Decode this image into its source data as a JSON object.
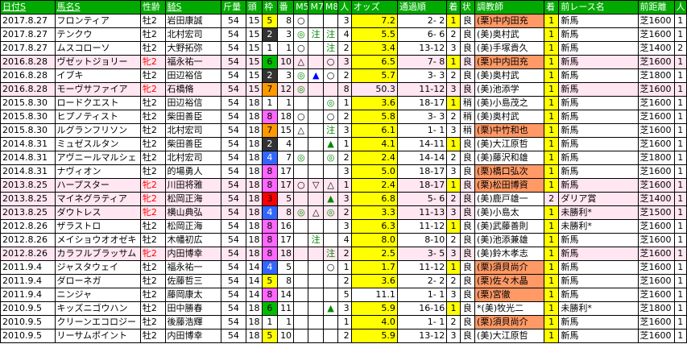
{
  "headers": {
    "date": "日付S",
    "horse": "馬名S",
    "sexage": "性齢",
    "jockey": "騎S",
    "weight": "斤量",
    "heads": "頭",
    "frame": "枠",
    "num": "番",
    "m5": "M5",
    "m7": "M7",
    "m8": "M8",
    "pop": "人",
    "odds": "オッズ",
    "passing": "通過順",
    "finish": "着",
    "cond": "状",
    "trainer": "調教師",
    "prev_finish": "着",
    "prev_race": "前レース名",
    "prev_dist": "前距離",
    "prev_pop": "人"
  },
  "rows": [
    {
      "date": "2017.8.27",
      "horse": "フロンティア",
      "sexage": "牡2",
      "jockey": "岩田康誠",
      "weight": "54",
      "heads": "15",
      "frame": "5",
      "num": "8",
      "m5": "○",
      "m7": "",
      "m8": "",
      "pop": "3",
      "odds": "7.2",
      "passing": "2- 2",
      "finish": "1",
      "cond": "良",
      "trainer": "(栗)中内田充",
      "prev_finish": "1",
      "prev_race": "新馬",
      "prev_dist": "芝1600",
      "prev_pop": "1"
    },
    {
      "date": "2017.8.27",
      "horse": "テンクウ",
      "sexage": "牡2",
      "jockey": "北村宏司",
      "weight": "54",
      "heads": "15",
      "frame": "2",
      "num": "3",
      "m5": "◎",
      "m7": "注",
      "m8": "注",
      "pop": "4",
      "odds": "5.5",
      "passing": "6- 6",
      "finish": "2",
      "cond": "良",
      "trainer": "(美)奥村武",
      "prev_finish": "1",
      "prev_race": "新馬",
      "prev_dist": "芝1600",
      "prev_pop": "1"
    },
    {
      "date": "2017.8.27",
      "horse": "ムスコローソ",
      "sexage": "牡2",
      "jockey": "大野拓弥",
      "weight": "54",
      "heads": "15",
      "frame": "1",
      "num": "1",
      "m5": "○",
      "m7": "",
      "m8": "注",
      "pop": "2",
      "odds": "3.4",
      "passing": "13-12",
      "finish": "3",
      "cond": "良",
      "trainer": "(美)手塚貴久",
      "prev_finish": "1",
      "prev_race": "新馬",
      "prev_dist": "芝1400",
      "prev_pop": "2"
    },
    {
      "date": "2016.8.28",
      "horse": "ヴゼットジョリー",
      "sexage": "牝2",
      "jockey": "福永祐一",
      "weight": "54",
      "heads": "15",
      "frame": "6",
      "num": "10",
      "m5": "△",
      "m7": "",
      "m8": "○",
      "pop": "3",
      "odds": "6.5",
      "passing": "7- 8",
      "finish": "1",
      "cond": "良",
      "trainer": "(栗)中内田充",
      "prev_finish": "1",
      "prev_race": "新馬",
      "prev_dist": "芝1600",
      "prev_pop": "1"
    },
    {
      "date": "2016.8.28",
      "horse": "イブキ",
      "sexage": "牡2",
      "jockey": "田辺裕信",
      "weight": "54",
      "heads": "15",
      "frame": "2",
      "num": "3",
      "m5": "◎",
      "m7": "▲",
      "m8": "○",
      "pop": "2",
      "odds": "5.7",
      "passing": "3- 3",
      "finish": "2",
      "cond": "良",
      "trainer": "(美)奥村武",
      "prev_finish": "1",
      "prev_race": "新馬",
      "prev_dist": "芝1800",
      "prev_pop": "1"
    },
    {
      "date": "2016.8.28",
      "horse": "モーヴサファイア",
      "sexage": "牝2",
      "jockey": "石橋脩",
      "weight": "54",
      "heads": "15",
      "frame": "7",
      "num": "12",
      "m5": "◎",
      "m7": "",
      "m8": "",
      "pop": "8",
      "odds": "50.3",
      "passing": "11-12",
      "finish": "3",
      "cond": "良",
      "trainer": "(美)池添学",
      "prev_finish": "1",
      "prev_race": "新馬",
      "prev_dist": "芝1600",
      "prev_pop": "1"
    },
    {
      "date": "2015.8.30",
      "horse": "ロードクエスト",
      "sexage": "牡2",
      "jockey": "田辺裕信",
      "weight": "54",
      "heads": "18",
      "frame": "1",
      "num": "1",
      "m5": "",
      "m7": "",
      "m8": "◎",
      "pop": "1",
      "odds": "3.6",
      "passing": "18-17",
      "finish": "1",
      "cond": "稍",
      "trainer": "(美)小島茂之",
      "prev_finish": "1",
      "prev_race": "新馬",
      "prev_dist": "芝1600",
      "prev_pop": "1"
    },
    {
      "date": "2015.8.30",
      "horse": "ヒプノティスト",
      "sexage": "牡2",
      "jockey": "柴田善臣",
      "weight": "54",
      "heads": "18",
      "frame": "8",
      "num": "18",
      "m5": "○",
      "m7": "",
      "m8": "○",
      "pop": "2",
      "odds": "5.8",
      "passing": "3- 3",
      "finish": "2",
      "cond": "稍",
      "trainer": "(美)奥村武",
      "prev_finish": "1",
      "prev_race": "新馬",
      "prev_dist": "芝1600",
      "prev_pop": "1"
    },
    {
      "date": "2015.8.30",
      "horse": "ルグランフリソン",
      "sexage": "牡2",
      "jockey": "北村宏司",
      "weight": "54",
      "heads": "18",
      "frame": "7",
      "num": "15",
      "m5": "△",
      "m7": "",
      "m8": "注",
      "pop": "3",
      "odds": "6.1",
      "passing": "1- 1",
      "finish": "3",
      "cond": "稍",
      "trainer": "(栗)中竹和也",
      "prev_finish": "1",
      "prev_race": "新馬",
      "prev_dist": "芝1600",
      "prev_pop": "1"
    },
    {
      "date": "2014.8.31",
      "horse": "ミュゼスルタン",
      "sexage": "牡2",
      "jockey": "柴田善臣",
      "weight": "54",
      "heads": "18",
      "frame": "2",
      "num": "4",
      "m5": "",
      "m7": "",
      "m8": "▲",
      "pop": "1",
      "odds": "4.1",
      "passing": "14-11",
      "finish": "1",
      "cond": "良",
      "trainer": "(美)大江原哲",
      "prev_finish": "1",
      "prev_race": "新馬",
      "prev_dist": "芝1600",
      "prev_pop": "1"
    },
    {
      "date": "2014.8.31",
      "horse": "アヴニールマルシェ",
      "sexage": "牡2",
      "jockey": "北村宏司",
      "weight": "54",
      "heads": "18",
      "frame": "4",
      "num": "7",
      "m5": "◎",
      "m7": "",
      "m8": "◎",
      "pop": "2",
      "odds": "2.4",
      "passing": "14-14",
      "finish": "2",
      "cond": "良",
      "trainer": "(美)藤沢和雄",
      "prev_finish": "1",
      "prev_race": "新馬",
      "prev_dist": "芝1800",
      "prev_pop": "1"
    },
    {
      "date": "2014.8.31",
      "horse": "ナヴィオン",
      "sexage": "牡2",
      "jockey": "的場勇人",
      "weight": "54",
      "heads": "18",
      "frame": "8",
      "num": "17",
      "m5": "",
      "m7": "",
      "m8": "",
      "pop": "3",
      "odds": "5.0",
      "passing": "18-17",
      "finish": "3",
      "cond": "良",
      "trainer": "(栗)橋口弘次",
      "prev_finish": "1",
      "prev_race": "新馬",
      "prev_dist": "芝1600",
      "prev_pop": "1"
    },
    {
      "date": "2013.8.25",
      "horse": "ハープスター",
      "sexage": "牝2",
      "jockey": "川田将雅",
      "weight": "54",
      "heads": "18",
      "frame": "8",
      "num": "17",
      "m5": "○",
      "m7": "▽",
      "m8": "△",
      "pop": "1",
      "odds": "2.4",
      "passing": "18-17",
      "finish": "1",
      "cond": "良",
      "trainer": "(栗)松田博資",
      "prev_finish": "1",
      "prev_race": "新馬",
      "prev_dist": "芝1600",
      "prev_pop": "1"
    },
    {
      "date": "2013.8.25",
      "horse": "マイネグラティア",
      "sexage": "牝2",
      "jockey": "松岡正海",
      "weight": "54",
      "heads": "18",
      "frame": "3",
      "num": "5",
      "m5": "",
      "m7": "",
      "m8": "▲",
      "pop": "3",
      "odds": "6.8",
      "passing": "5- 6",
      "finish": "2",
      "cond": "良",
      "trainer": "(美)鹿戸雄一",
      "prev_finish": "2",
      "prev_race": "ダリア賞",
      "prev_dist": "芝1400",
      "prev_pop": "1"
    },
    {
      "date": "2013.8.25",
      "horse": "ダウトレス",
      "sexage": "牝2",
      "jockey": "横山典弘",
      "weight": "54",
      "heads": "18",
      "frame": "4",
      "num": "8",
      "m5": "◎",
      "m7": "△",
      "m8": "◎",
      "pop": "2",
      "odds": "3.3",
      "passing": "11-13",
      "finish": "3",
      "cond": "良",
      "trainer": "(美)小島太",
      "prev_finish": "1",
      "prev_race": "未勝利*",
      "prev_dist": "芝1500",
      "prev_pop": "1"
    },
    {
      "date": "2012.8.26",
      "horse": "ザラストロ",
      "sexage": "牡2",
      "jockey": "松岡正海",
      "weight": "54",
      "heads": "18",
      "frame": "8",
      "num": "16",
      "m5": "",
      "m7": "",
      "m8": "",
      "pop": "3",
      "odds": "6.3",
      "passing": "11-12",
      "finish": "1",
      "cond": "良",
      "trainer": "(美)武藤善則",
      "prev_finish": "1",
      "prev_race": "未勝利*",
      "prev_dist": "芝1600",
      "prev_pop": "1"
    },
    {
      "date": "2012.8.26",
      "horse": "メイショウオオゼキ",
      "sexage": "牡2",
      "jockey": "木幡初広",
      "weight": "54",
      "heads": "18",
      "frame": "8",
      "num": "17",
      "m5": "",
      "m7": "注",
      "m8": "",
      "pop": "4",
      "odds": "8.0",
      "passing": "8-10",
      "finish": "2",
      "cond": "良",
      "trainer": "(美)池添兼雄",
      "prev_finish": "1",
      "prev_race": "新馬",
      "prev_dist": "芝1600",
      "prev_pop": "1"
    },
    {
      "date": "2012.8.26",
      "horse": "カラフルブラッサム",
      "sexage": "牝2",
      "jockey": "内田博幸",
      "weight": "54",
      "heads": "18",
      "frame": "8",
      "num": "18",
      "m5": "",
      "m7": "",
      "m8": "注",
      "pop": "2",
      "odds": "2.5",
      "passing": "3- 5",
      "finish": "3",
      "cond": "良",
      "trainer": "(美)鈴木孝志",
      "prev_finish": "1",
      "prev_race": "新馬",
      "prev_dist": "芝1600",
      "prev_pop": "1"
    },
    {
      "date": "2011.9.4",
      "horse": "ジャスタウェイ",
      "sexage": "牡2",
      "jockey": "福永祐一",
      "weight": "54",
      "heads": "14",
      "frame": "4",
      "num": "5",
      "m5": "",
      "m7": "",
      "m8": "○",
      "pop": "1",
      "odds": "1.7",
      "passing": "11-12",
      "finish": "1",
      "cond": "良",
      "trainer": "(栗)須貝尚介",
      "prev_finish": "1",
      "prev_race": "新馬",
      "prev_dist": "芝1600",
      "prev_pop": "1"
    },
    {
      "date": "2011.9.4",
      "horse": "ダローネガ",
      "sexage": "牡2",
      "jockey": "佐藤哲三",
      "weight": "54",
      "heads": "14",
      "frame": "5",
      "num": "8",
      "m5": "",
      "m7": "",
      "m8": "",
      "pop": "2",
      "odds": "3.6",
      "passing": "2- 2",
      "finish": "2",
      "cond": "良",
      "trainer": "(栗)佐々木晶",
      "prev_finish": "1",
      "prev_race": "新馬",
      "prev_dist": "芝1600",
      "prev_pop": "1"
    },
    {
      "date": "2011.9.4",
      "horse": "ニンジャ",
      "sexage": "牡2",
      "jockey": "藤岡康太",
      "weight": "54",
      "heads": "14",
      "frame": "8",
      "num": "14",
      "m5": "",
      "m7": "",
      "m8": "",
      "pop": "5",
      "odds": "11.1",
      "passing": "1- 1",
      "finish": "3",
      "cond": "良",
      "trainer": "(栗)宮徹",
      "prev_finish": "1",
      "prev_race": "新馬",
      "prev_dist": "芝1600",
      "prev_pop": "1"
    },
    {
      "date": "2010.9.5",
      "horse": "キッズニゴウハン",
      "sexage": "牡2",
      "jockey": "田中勝春",
      "weight": "54",
      "heads": "18",
      "frame": "6",
      "num": "11",
      "m5": "",
      "m7": "",
      "m8": "▲",
      "pop": "3",
      "odds": "5.9",
      "passing": "16-16",
      "finish": "1",
      "cond": "良",
      "trainer": "*(美)牧光二",
      "prev_finish": "1",
      "prev_race": "未勝利*",
      "prev_dist": "芝1800",
      "prev_pop": "1"
    },
    {
      "date": "2010.9.5",
      "horse": "クリーンエコロジー",
      "sexage": "牡2",
      "jockey": "後藤浩輝",
      "weight": "54",
      "heads": "18",
      "frame": "1",
      "num": "1",
      "m5": "",
      "m7": "",
      "m8": "",
      "pop": "1",
      "odds": "4.0",
      "passing": "1- 1",
      "finish": "2",
      "cond": "良",
      "trainer": "(栗)須貝尚介",
      "prev_finish": "1",
      "prev_race": "新馬",
      "prev_dist": "芝1600",
      "prev_pop": "1"
    },
    {
      "date": "2010.9.5",
      "horse": "リーサムポイント",
      "sexage": "牡2",
      "jockey": "内田博幸",
      "weight": "54",
      "heads": "18",
      "frame": "5",
      "num": "10",
      "m5": "",
      "m7": "",
      "m8": "",
      "pop": "2",
      "odds": "5.9",
      "passing": "13-12",
      "finish": "3",
      "cond": "良",
      "trainer": "(美)大江原哲",
      "prev_finish": "1",
      "prev_race": "新馬",
      "prev_dist": "芝1600",
      "prev_pop": "1"
    }
  ],
  "colors": {
    "header_bg": "#00aa00",
    "pink_row": "#ffe6f0",
    "white_row": "#ffffff",
    "frame_1": "#ffffff",
    "frame_2": "#333333",
    "frame_3": "#ff0000",
    "frame_4": "#3366ff",
    "frame_5": "#ffff00",
    "frame_6": "#00bb00",
    "frame_7": "#ff9900",
    "frame_8": "#ff66ff",
    "odds_fav": "#ffff00",
    "finish_win": "#ffff00",
    "trainer_kuri": "#ff9966",
    "trainer_mi": "#ffffff",
    "jockey_highlight": "#ccffcc"
  }
}
